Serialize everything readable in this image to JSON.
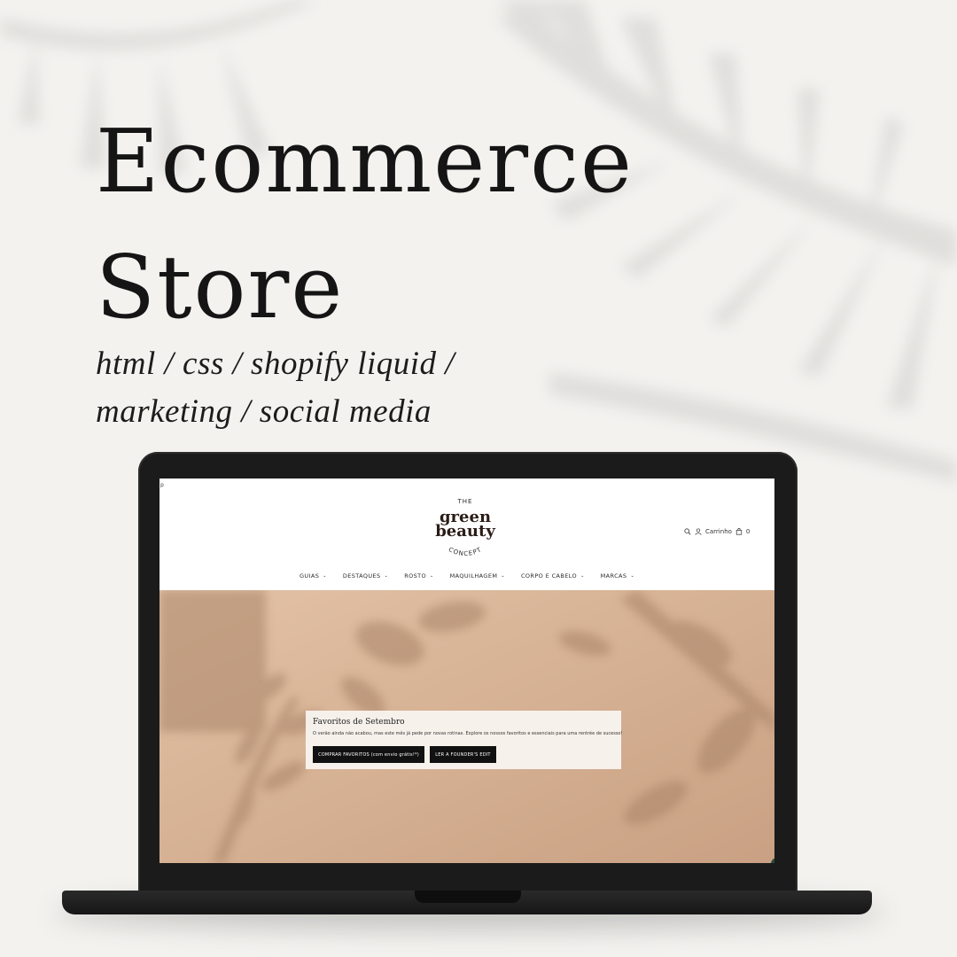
{
  "headline": {
    "line1": "Ecommerce",
    "line2": "Store"
  },
  "subtitle": {
    "line1": "html / css / shopify liquid /",
    "line2": "marketing / social media"
  },
  "site": {
    "corner_mark": "p",
    "logo": {
      "the": "THE",
      "green": "green",
      "beauty": "beauty",
      "concept": "CONCEPT"
    },
    "header": {
      "cart_label": "Carrinho",
      "cart_count": "0"
    },
    "nav": [
      {
        "label": "GUIAS"
      },
      {
        "label": "DESTAQUES"
      },
      {
        "label": "ROSTO"
      },
      {
        "label": "MAQUILHAGEM"
      },
      {
        "label": "CORPO E CABELO"
      },
      {
        "label": "MARCAS"
      }
    ],
    "promo": {
      "title": "Favoritos de Setembro",
      "text": "O verão ainda não acabou, mas este mês já pede por novas rotinas. Explore os nossos favoritos e essenciais para uma rentrée de sucesso!",
      "button_primary": "COMPRAR FAVORITOS (com envio grátis!*)",
      "button_secondary": "LER A FOUNDER'S EDIT"
    }
  },
  "colors": {
    "background": "#f3f2ef",
    "hero": "#d9b497",
    "button": "#111111",
    "chat": "#264b3e"
  }
}
